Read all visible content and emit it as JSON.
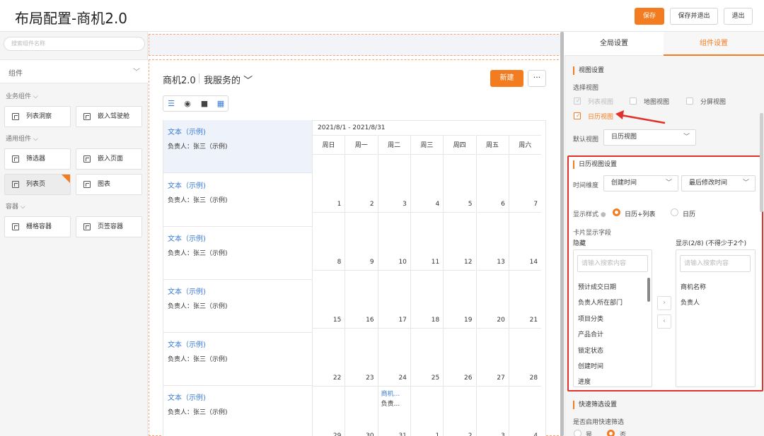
{
  "header": {
    "title": "布局配置-商机2.0",
    "save": "保存",
    "save_exit": "保存并退出",
    "exit": "退出"
  },
  "left": {
    "search_placeholder": "搜索组件名称",
    "components_label": "组件",
    "groups": [
      {
        "label": "业务组件",
        "items": [
          "列表洞察",
          "嵌入驾驶舱"
        ]
      },
      {
        "label": "通用组件",
        "items": [
          "筛选器",
          "嵌入页面",
          "列表页",
          "图表"
        ]
      },
      {
        "label": "容器",
        "items": [
          "栅格容器",
          "页签容器"
        ]
      }
    ]
  },
  "middle": {
    "title": "商机2.0",
    "view": "我服务的",
    "new_btn": "新建",
    "more_btn": "···",
    "cards": [
      {
        "title": "文本（示例)",
        "owner": "负责人：张三（示例)"
      },
      {
        "title": "文本（示例)",
        "owner": "负责人：张三（示例)"
      },
      {
        "title": "文本（示例)",
        "owner": "负责人：张三（示例)"
      },
      {
        "title": "文本（示例)",
        "owner": "负责人：张三（示例)"
      },
      {
        "title": "文本（示例)",
        "owner": "负责人：张三（示例)"
      },
      {
        "title": "文本（示例)",
        "owner": "负责人：张三（示例)"
      }
    ],
    "calendar": {
      "range": "2021/8/1 - 2021/8/31",
      "weekdays": [
        "周日",
        "周一",
        "周二",
        "周三",
        "周四",
        "周五",
        "周六"
      ],
      "weeks": [
        [
          "1",
          "2",
          "3",
          "4",
          "5",
          "6",
          "7"
        ],
        [
          "8",
          "9",
          "10",
          "11",
          "12",
          "13",
          "14"
        ],
        [
          "15",
          "16",
          "17",
          "18",
          "19",
          "20",
          "21"
        ],
        [
          "22",
          "23",
          "24",
          "25",
          "26",
          "27",
          "28"
        ],
        [
          "29",
          "30",
          "31",
          "1",
          "2",
          "3",
          "4"
        ]
      ],
      "event_title": "商机...",
      "event_owner": "负责..."
    }
  },
  "right": {
    "tab_global": "全局设置",
    "tab_component": "组件设置",
    "view_settings": "视图设置",
    "choose_view": "选择视图",
    "views": {
      "list": "列表视图",
      "map": "地图视图",
      "split": "分屏视图",
      "calendar": "日历视图"
    },
    "default_view_label": "默认视图",
    "default_view_value": "日历视图",
    "cal_settings": "日历视图设置",
    "time_dim_label": "时间维度",
    "time_dim_1": "创建时间",
    "time_dim_2": "最后修改时间",
    "display_style_label": "显示样式",
    "style_opt1": "日历+列表",
    "style_opt2": "日历",
    "card_fields_label": "卡片显示字段",
    "hidden_label": "隐藏",
    "shown_label": "显示(2/8) (不得少于2个)",
    "search_placeholder": "请输入搜索内容",
    "hidden_fields": [
      "预计成交日期",
      "负责人所在部门",
      "项目分类",
      "产品合计",
      "锁定状态",
      "创建时间",
      "进度"
    ],
    "shown_fields": [
      "商机名称",
      "负责人"
    ],
    "quick_filter": "快速筛选设置",
    "quick_filter_q": "是否启用快速筛选",
    "yes": "是",
    "no": "否"
  },
  "colors": {
    "accent": "#f47c20",
    "link": "#3a7bd5",
    "highlight": "#e0312a"
  }
}
